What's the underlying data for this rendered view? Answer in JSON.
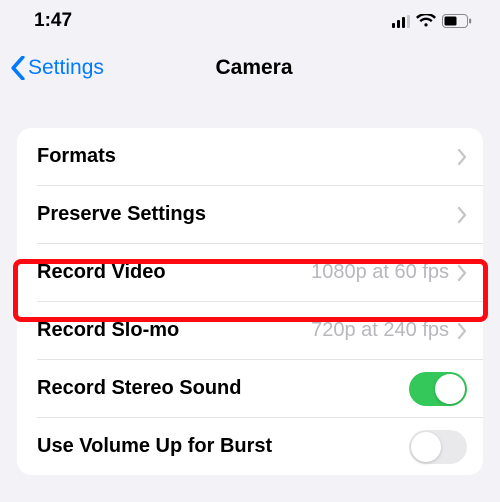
{
  "status": {
    "time": "1:47"
  },
  "nav": {
    "back": "Settings",
    "title": "Camera"
  },
  "rows": {
    "formats": {
      "label": "Formats"
    },
    "preserve": {
      "label": "Preserve Settings"
    },
    "record_video": {
      "label": "Record Video",
      "detail": "1080p at 60 fps"
    },
    "record_slomo": {
      "label": "Record Slo-mo",
      "detail": "720p at 240 fps"
    },
    "stereo": {
      "label": "Record Stereo Sound"
    },
    "volume_burst": {
      "label": "Use Volume Up for Burst"
    }
  }
}
